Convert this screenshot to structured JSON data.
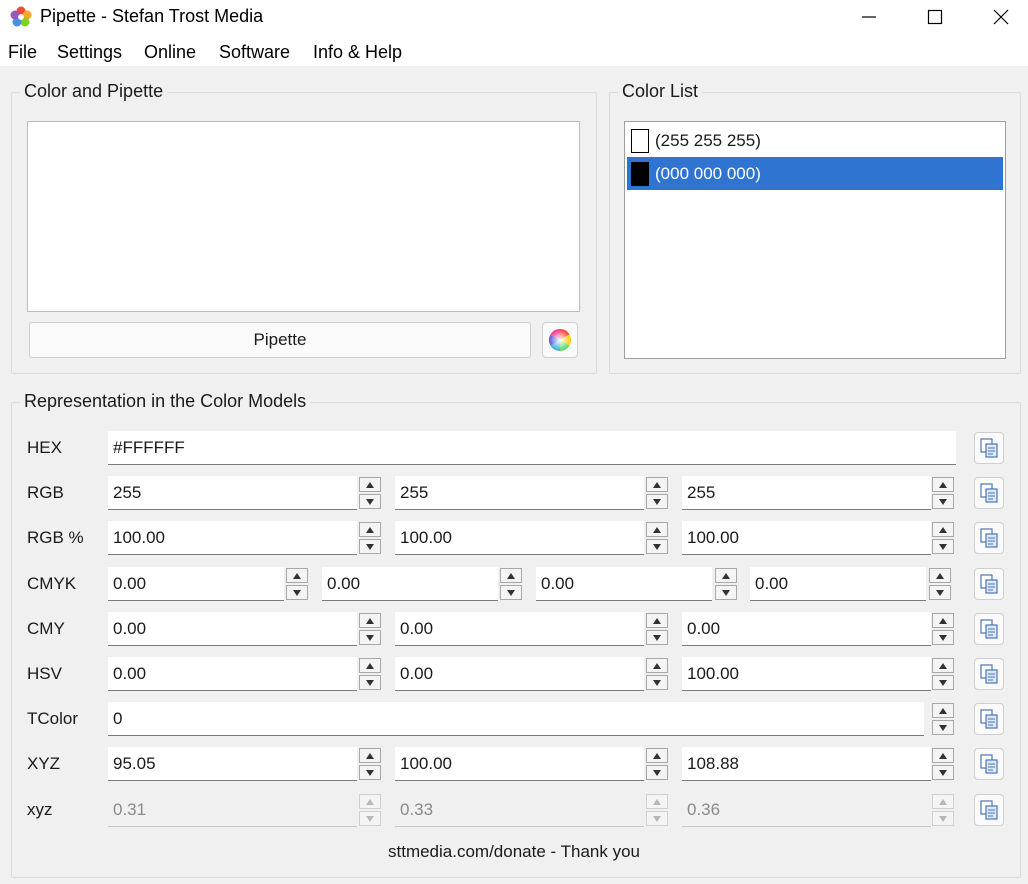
{
  "window": {
    "title": "Pipette - Stefan Trost Media",
    "app_icon": "flower-app-icon",
    "controls": [
      "minimize-icon",
      "maximize-icon",
      "close-icon"
    ]
  },
  "menu": [
    "File",
    "Settings",
    "Online",
    "Software",
    "Info & Help"
  ],
  "color_pipette": {
    "title": "Color and Pipette",
    "pipette_button": "Pipette",
    "color_wheel_icon": "color-wheel-icon"
  },
  "color_list": {
    "title": "Color List",
    "items": [
      {
        "label": "(255 255 255)",
        "swatch": "#ffffff",
        "selected": false
      },
      {
        "label": "(000 000 000)",
        "swatch": "#000000",
        "selected": true
      }
    ]
  },
  "models": {
    "title": "Representation in the Color Models",
    "rows": [
      {
        "label": "HEX",
        "values": [
          "#FFFFFF"
        ]
      },
      {
        "label": "RGB",
        "values": [
          "255",
          "255",
          "255"
        ]
      },
      {
        "label": "RGB %",
        "values": [
          "100.00",
          "100.00",
          "100.00"
        ]
      },
      {
        "label": "CMYK",
        "values": [
          "0.00",
          "0.00",
          "0.00",
          "0.00"
        ]
      },
      {
        "label": "CMY",
        "values": [
          "0.00",
          "0.00",
          "0.00"
        ]
      },
      {
        "label": "HSV",
        "values": [
          "0.00",
          "0.00",
          "100.00"
        ]
      },
      {
        "label": "TColor",
        "values": [
          "0"
        ]
      },
      {
        "label": "XYZ",
        "values": [
          "95.05",
          "100.00",
          "108.88"
        ]
      },
      {
        "label": "xyz",
        "values": [
          "0.31",
          "0.33",
          "0.36"
        ],
        "disabled": true
      }
    ]
  },
  "footer": "sttmedia.com/donate - Thank you",
  "colors": {
    "selection": "#2f74d0",
    "background": "#f0f0f0"
  }
}
